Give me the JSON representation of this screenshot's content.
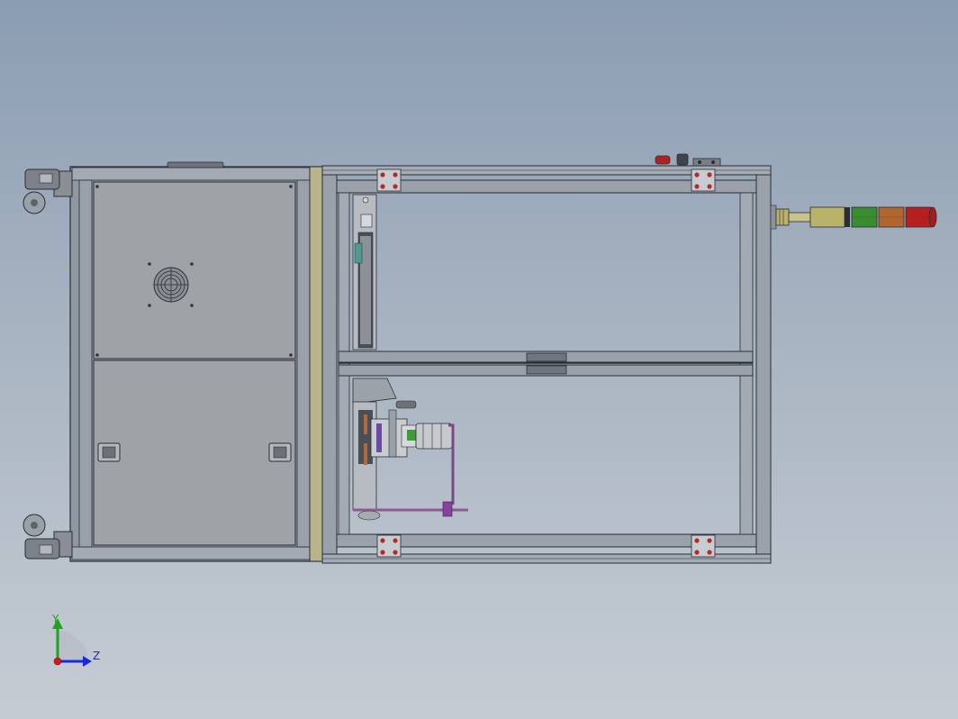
{
  "viewport": {
    "background_top": "#8b9db2",
    "background_bottom": "#c6ccd4"
  },
  "triad": {
    "y_label": "Y",
    "z_label": "Z",
    "y_color": "#1ea31e",
    "z_color": "#1a2bd6",
    "x_color": "#d21a1a"
  },
  "model": {
    "frame_color": "#7e8591",
    "panel_color": "#9ea2a7",
    "tower_light_colors": [
      "#3a8d2e",
      "#b0662e",
      "#b81f1f"
    ],
    "tower_base_color": "#b9b26b"
  }
}
